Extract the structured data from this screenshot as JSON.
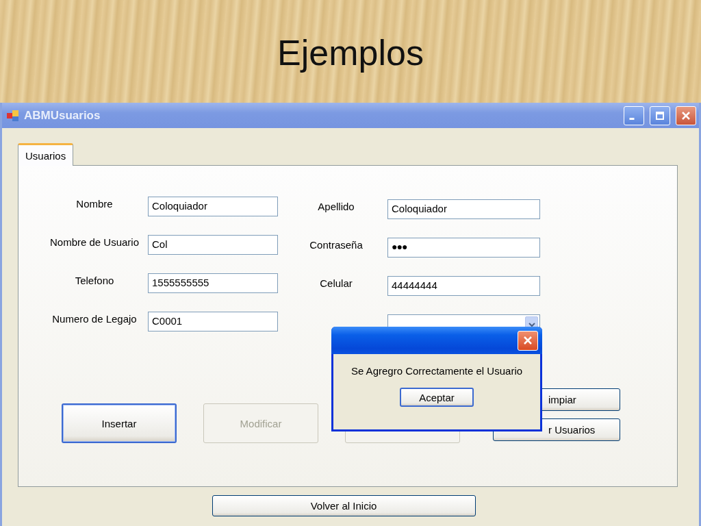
{
  "slide": {
    "title": "Ejemplos"
  },
  "window": {
    "title": "ABMUsuarios"
  },
  "tabs": [
    {
      "label": "Usuarios",
      "selected": true
    }
  ],
  "fields_left": [
    {
      "label": "Nombre",
      "value": "Coloquiador"
    },
    {
      "label": "Nombre de Usuario",
      "value": "Col"
    },
    {
      "label": "Telefono",
      "value": "1555555555"
    },
    {
      "label": "Numero de Legajo",
      "value": "C0001"
    }
  ],
  "fields_right": [
    {
      "kind": "text",
      "label": "Apellido",
      "value": "Coloquiador"
    },
    {
      "kind": "password",
      "label": "Contraseña",
      "value": "●●●"
    },
    {
      "kind": "text",
      "label": "Celular",
      "value": "44444444"
    },
    {
      "kind": "dropdown"
    }
  ],
  "buttons": [
    {
      "label": "Insertar",
      "disabled": false,
      "default": true
    },
    {
      "label": "Modificar",
      "disabled": true,
      "default": false
    },
    {
      "disabled": true,
      "default": false
    }
  ],
  "side_buttons": [
    {
      "label": "impiar"
    },
    {
      "label": "r Usuarios"
    }
  ],
  "footer_button": {
    "label": "Volver al Inicio"
  },
  "dialog": {
    "message": "Se Agregro Correctamente el Usuario",
    "button": "Aceptar"
  }
}
